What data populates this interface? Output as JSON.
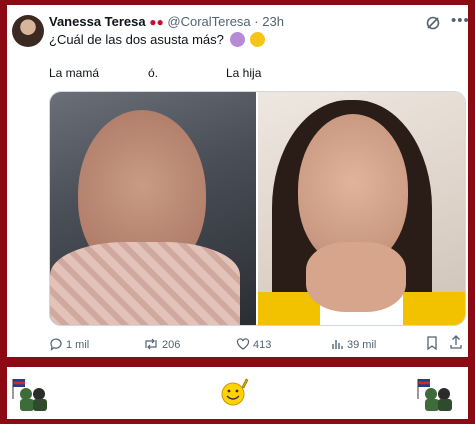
{
  "post": {
    "display_name": "Vanessa Teresa",
    "handle": "@CoralTeresa",
    "separator": "·",
    "time": "23h",
    "text": "¿Cuál de las dos asusta más?",
    "labels": {
      "left": "La mamá",
      "middle": "ó.",
      "right": "La hija"
    }
  },
  "actions": {
    "replies": "1 mil",
    "reposts": "206",
    "likes": "413",
    "views": "39 mil"
  },
  "icons": [
    "cherry-icon",
    "grok-icon",
    "more-icon",
    "reply-icon",
    "repost-icon",
    "like-icon",
    "views-icon",
    "bookmark-icon",
    "share-icon",
    "woman-gesturing-emoji",
    "money-face-emoji"
  ],
  "colors": {
    "background": "#8b0a14",
    "text": "#0f1419",
    "muted": "#536471"
  }
}
